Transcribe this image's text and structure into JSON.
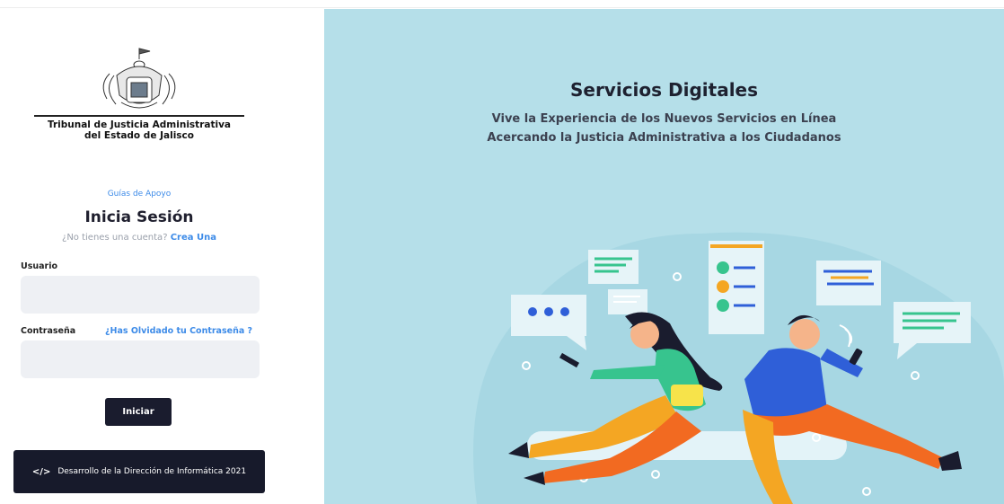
{
  "org": {
    "line1": "Tribunal de Justicia Administrativa",
    "line2": "del Estado de Jalisco"
  },
  "login": {
    "help_link": "Guías de Apoyo",
    "title": "Inicia Sesión",
    "no_account_text": "¿No tienes una cuenta?",
    "create_link": "Crea Una",
    "user_label": "Usuario",
    "user_value": "",
    "password_label": "Contraseña",
    "forgot_link": "¿Has Olvidado tu Contraseña ?",
    "password_value": "",
    "submit_label": "Iniciar"
  },
  "footer": {
    "code_icon": "</>",
    "text": "Desarrollo de la Dirección de Informática 2021"
  },
  "hero": {
    "title": "Servicios Digitales",
    "subtitle_line1": "Vive la Experiencia de los Nuevos Servicios en Línea",
    "subtitle_line2": "Acercando la Justicia Administrativa a los Ciudadanos"
  },
  "colors": {
    "accent_link": "#3d8be8",
    "button_dark": "#1a1c2e",
    "hero_bg": "#b5dfe9"
  }
}
